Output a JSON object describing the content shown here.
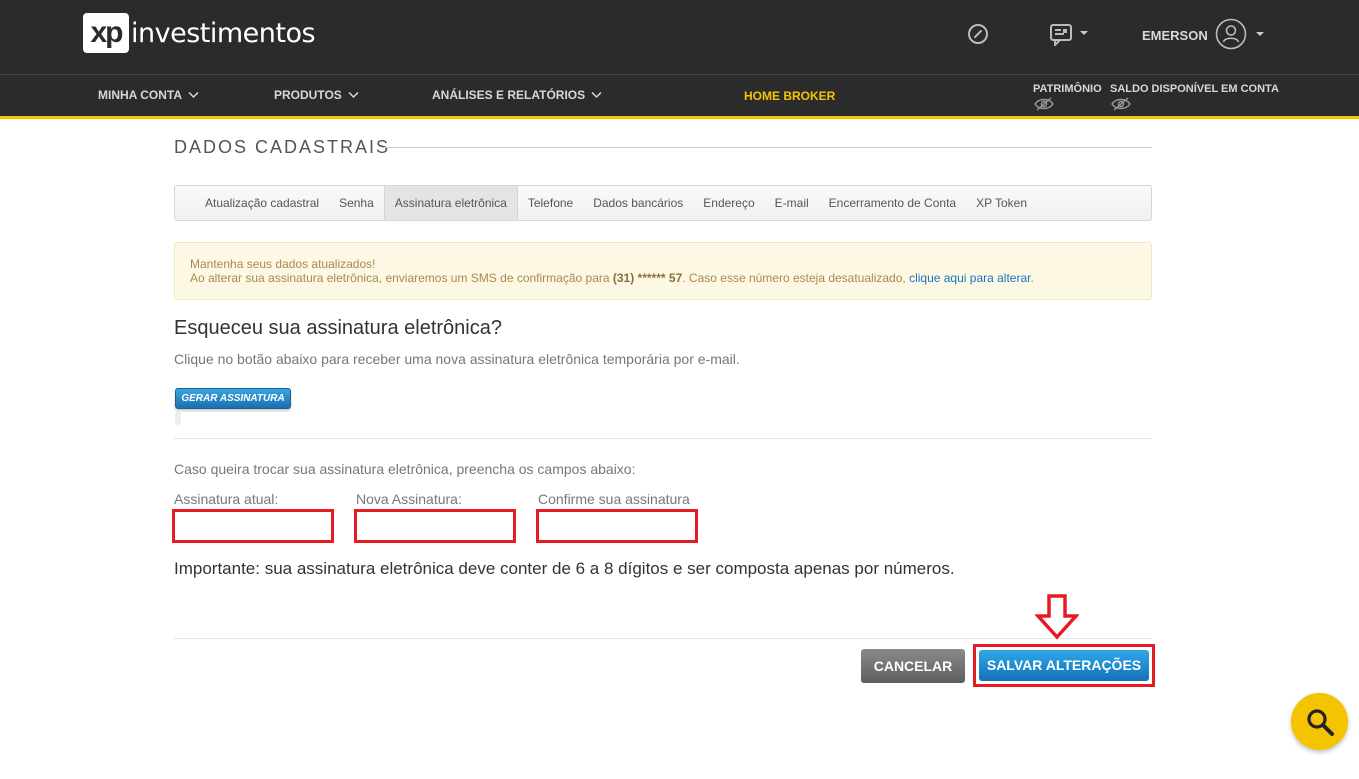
{
  "header": {
    "logo_mark": "xp",
    "logo_word": "investimentos",
    "user_name": "EMERSON",
    "icons": [
      "compass-icon",
      "chat-icon",
      "user-icon"
    ]
  },
  "nav": {
    "minha_conta": "MINHA CONTA",
    "produtos": "PRODUTOS",
    "analises": "ANÁLISES E RELATÓRIOS",
    "home_broker": "HOME BROKER",
    "patrimonio": "PATRIMÔNIO",
    "saldo": "SALDO DISPONÍVEL EM CONTA"
  },
  "page": {
    "title": "DADOS CADASTRAIS",
    "tabs": [
      {
        "label": "Atualização cadastral"
      },
      {
        "label": "Senha"
      },
      {
        "label": "Assinatura eletrônica",
        "active": true
      },
      {
        "label": "Telefone"
      },
      {
        "label": "Dados bancários"
      },
      {
        "label": "Endereço"
      },
      {
        "label": "E-mail"
      },
      {
        "label": "Encerramento de Conta"
      },
      {
        "label": "XP Token"
      }
    ]
  },
  "alert": {
    "line1": "Mantenha seus dados atualizados!",
    "line2_prefix": "Ao alterar sua assinatura eletrônica, enviaremos um SMS de confirmação para ",
    "phone": "(31) ****** 57",
    "line2_suffix": ". Caso esse número esteja desatualizado, ",
    "link": "clique aqui para alterar",
    "end": "."
  },
  "forgot": {
    "heading": "Esqueceu sua assinatura eletrônica?",
    "text": "Clique no botão abaixo para receber uma nova assinatura eletrônica temporária por e-mail.",
    "button": "GERAR ASSINATURA"
  },
  "change": {
    "text": "Caso queira trocar sua assinatura eletrônica, preencha os campos abaixo:",
    "current_label": "Assinatura atual:",
    "new_label": "Nova Assinatura:",
    "confirm_label": "Confirme sua assinatura",
    "current_value": "",
    "new_value": "",
    "confirm_value": "",
    "important": "Importante: sua assinatura eletrônica deve conter de 6 a 8 dígitos e ser composta apenas por números."
  },
  "actions": {
    "cancel": "CANCELAR",
    "save": "SALVAR ALTERAÇÕES"
  },
  "colors": {
    "accent_yellow": "#f5c400",
    "header_bg": "#2b2b2b",
    "highlight_red": "#e41b23",
    "primary_blue": "#1b7fc9"
  }
}
